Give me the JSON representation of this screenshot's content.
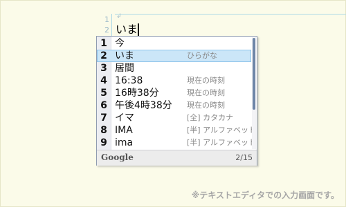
{
  "editor": {
    "line_numbers": [
      "1",
      "2"
    ],
    "eol_mark": "↲",
    "composition_text": "いま"
  },
  "candidates": {
    "items": [
      {
        "index": "1",
        "text": "今",
        "description": ""
      },
      {
        "index": "2",
        "text": "いま",
        "description": "ひらがな"
      },
      {
        "index": "3",
        "text": "居間",
        "description": ""
      },
      {
        "index": "4",
        "text": "16:38",
        "description": "現在の時刻"
      },
      {
        "index": "5",
        "text": "16時38分",
        "description": "現在の時刻"
      },
      {
        "index": "6",
        "text": "午後4時38分",
        "description": "現在の時刻"
      },
      {
        "index": "7",
        "text": "イマ",
        "description": "[全] カタカナ"
      },
      {
        "index": "8",
        "text": "IMA",
        "description": "[半] アルファベット"
      },
      {
        "index": "9",
        "text": "ima",
        "description": "[半] アルファベット"
      }
    ],
    "selected_index": "2",
    "footer": {
      "brand": "Google",
      "page": "2/15"
    }
  },
  "caption": "※テキストエディタでの入力画面です。",
  "colors": {
    "background": "#fbfbe9",
    "selected_row": "#cbe6f8",
    "selected_outline": "#8cc3ea",
    "scroll_thumb": "#6f86a8"
  }
}
